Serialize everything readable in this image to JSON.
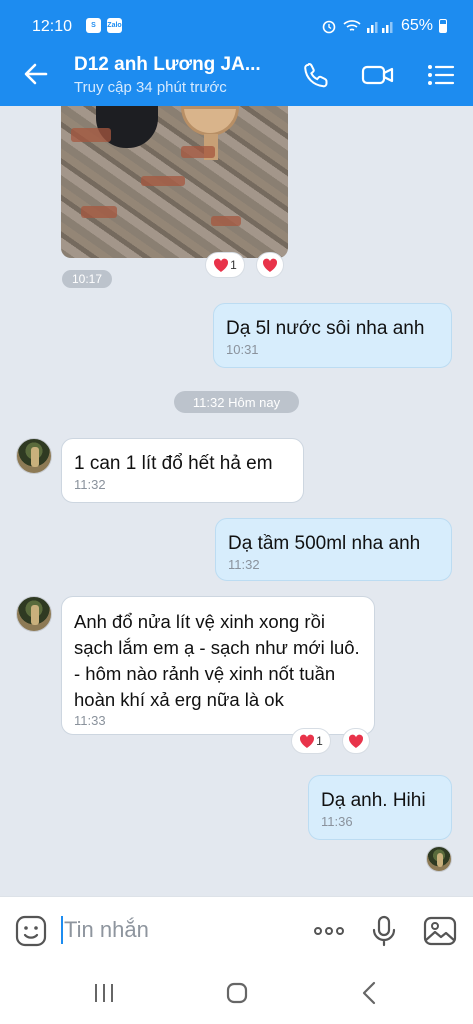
{
  "status_bar": {
    "time": "12:10",
    "battery": "65%",
    "app_badge": "Zalo"
  },
  "header": {
    "title": "D12 anh Lương JA...",
    "subtitle": "Truy cập 34 phút trước"
  },
  "messages": {
    "photo_time": "10:17",
    "photo_reaction_count": "1",
    "m1": {
      "text": "Dạ 5l nước sôi nha anh",
      "time": "10:31"
    },
    "date_divider": "11:32 Hôm nay",
    "m2": {
      "text": "1 can 1 lít đổ hết hả em",
      "time": "11:32"
    },
    "m3": {
      "text": "Dạ tầm 500ml nha anh",
      "time": "11:32"
    },
    "m4": {
      "text": "Anh đổ nửa lít vệ xinh xong rồi sạch lắm em ạ - sạch như mới luô. - hôm nào rảnh vệ xinh nốt tuần hoàn khí xả erg nữa là ok",
      "time": "11:33",
      "reaction_count": "1"
    },
    "m5": {
      "text": "Dạ anh. Hihi",
      "time": "11:36"
    }
  },
  "input": {
    "placeholder": "Tin nhắn",
    "value": ""
  },
  "colors": {
    "accent": "#1d8cf0",
    "outgoing_bubble": "#d7edfc",
    "incoming_bubble": "#ffffff",
    "background": "#e3e8ef",
    "heart": "#e8334a"
  },
  "icons": [
    "back-arrow-icon",
    "phone-icon",
    "video-call-icon",
    "menu-icon",
    "sticker-icon",
    "more-icon",
    "microphone-icon",
    "image-icon",
    "recent-apps-icon",
    "home-icon",
    "back-nav-icon",
    "heart-icon"
  ]
}
